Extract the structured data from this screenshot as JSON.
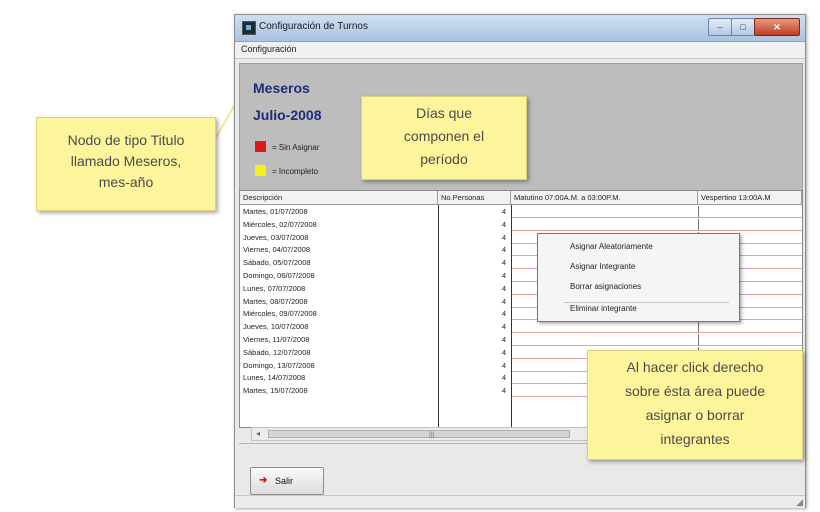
{
  "window": {
    "title": "Configuración de Turnos",
    "buttons": {
      "close": "✕",
      "min": "–",
      "max": "□"
    }
  },
  "menubar": {
    "items": [
      "Configuración"
    ]
  },
  "header": {
    "group_title": "Meseros",
    "period": "Julio-2008",
    "legend": [
      {
        "color": "#e01818",
        "label": "= Sin Asignar"
      },
      {
        "color": "#f2f218",
        "label": "= Incompleto"
      }
    ]
  },
  "grid": {
    "columns": [
      "Descripción",
      "No.Personas",
      "Matutino 07:00A.M. a 03:00P.M.",
      "Vespertino 13:00A.M"
    ],
    "rows": [
      {
        "desc": "Martes, 01/07/2008",
        "np": "4"
      },
      {
        "desc": "Miércoles, 02/07/2008",
        "np": "4"
      },
      {
        "desc": "Jueves, 03/07/2008",
        "np": "4"
      },
      {
        "desc": "Viernes, 04/07/2008",
        "np": "4"
      },
      {
        "desc": "Sábado, 05/07/2008",
        "np": "4"
      },
      {
        "desc": "Domingo, 06/07/2008",
        "np": "4"
      },
      {
        "desc": "Lunes, 07/07/2008",
        "np": "4"
      },
      {
        "desc": "Martes, 08/07/2008",
        "np": "4"
      },
      {
        "desc": "Miércoles, 09/07/2008",
        "np": "4"
      },
      {
        "desc": "Jueves, 10/07/2008",
        "np": "4"
      },
      {
        "desc": "Viernes, 11/07/2008",
        "np": "4"
      },
      {
        "desc": "Sábado, 12/07/2008",
        "np": "4"
      },
      {
        "desc": "Domingo, 13/07/2008",
        "np": "4"
      },
      {
        "desc": "Lunes, 14/07/2008",
        "np": "4"
      },
      {
        "desc": "Martes, 15/07/2008",
        "np": "4"
      }
    ]
  },
  "context_menu": {
    "items": [
      "Asignar Aleatoriamente",
      "Asignar Integrante",
      "Borrar asignaciones",
      "Eliminar integrante"
    ]
  },
  "footer": {
    "exit_label": "Salir"
  },
  "notes": {
    "title_node": [
      "Nodo de tipo Titulo",
      "llamado Meseros,",
      "mes-año"
    ],
    "days": [
      "Días que",
      "componen el",
      "período"
    ],
    "right_click": [
      "Al hacer click derecho",
      "sobre ésta área puede",
      "asignar o borrar",
      "integrantes"
    ]
  },
  "colors": {
    "title_text": "#1c2c7a",
    "grid_line": "#e6a3a3",
    "note_bg": "#fdf59c"
  }
}
